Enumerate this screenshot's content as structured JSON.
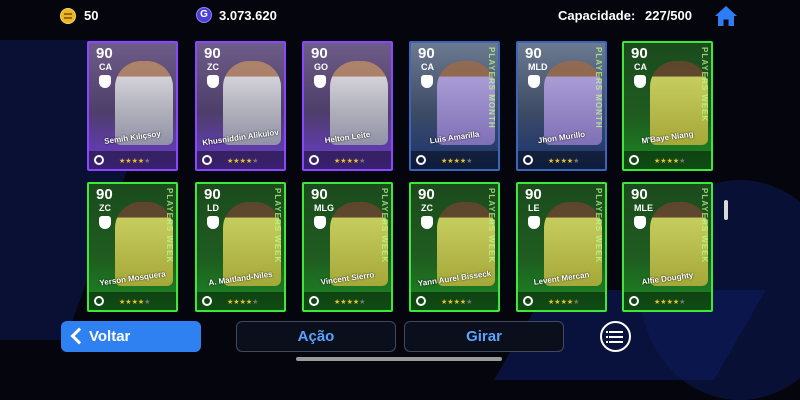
{
  "header": {
    "coins": "50",
    "gp": "3.073.620",
    "gp_icon_letter": "G",
    "capacity_label": "Capacidade:",
    "capacity_value": "227/500"
  },
  "cards": [
    {
      "rating": "90",
      "position": "CA",
      "name": "Semih Kılıçsoy",
      "style": "purple",
      "stars": 4
    },
    {
      "rating": "90",
      "position": "ZC",
      "name": "Khusniddin Alikulov",
      "style": "purple",
      "stars": 4
    },
    {
      "rating": "90",
      "position": "GO",
      "name": "Helton Leite",
      "style": "purple",
      "stars": 4
    },
    {
      "rating": "90",
      "position": "CA",
      "name": "Luis Amarilla",
      "style": "blue",
      "stars": 4
    },
    {
      "rating": "90",
      "position": "MLD",
      "name": "Jhon Murillo",
      "style": "blue",
      "stars": 4
    },
    {
      "rating": "90",
      "position": "CA",
      "name": "M'Baye Niang",
      "style": "green",
      "stars": 4
    },
    {
      "rating": "90",
      "position": "ZC",
      "name": "Yerson Mosquera",
      "style": "green",
      "stars": 4
    },
    {
      "rating": "90",
      "position": "LD",
      "name": "A. Maitland-Niles",
      "style": "green",
      "stars": 4
    },
    {
      "rating": "90",
      "position": "MLG",
      "name": "Vincent Sierro",
      "style": "green",
      "stars": 4
    },
    {
      "rating": "90",
      "position": "ZC",
      "name": "Yann Aurel Bisseck",
      "style": "green",
      "stars": 4
    },
    {
      "rating": "90",
      "position": "LE",
      "name": "Levent Mercan",
      "style": "green",
      "stars": 4
    },
    {
      "rating": "90",
      "position": "MLE",
      "name": "Alfie Doughty",
      "style": "green",
      "stars": 4
    }
  ],
  "card_tags": {
    "blue": "PLAYERS MONTH",
    "green": "PLAYERS WEEK"
  },
  "footer": {
    "back_label": "Voltar",
    "action_label": "Ação",
    "spin_label": "Girar"
  },
  "colors": {
    "accent_blue": "#2f80f0",
    "card_purple": "#8a47ff",
    "card_blue": "#3a65b8",
    "card_green": "#3de83a"
  }
}
